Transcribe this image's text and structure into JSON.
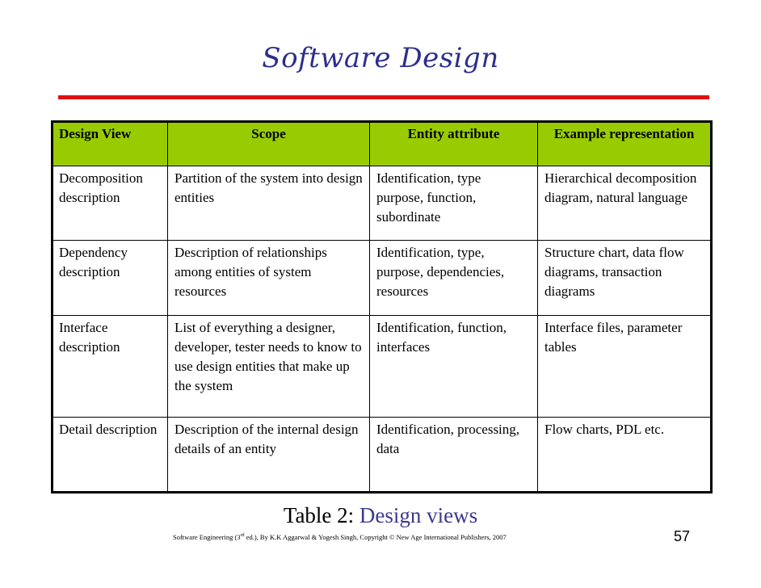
{
  "slide": {
    "title": "Software Design",
    "accent_color": "#2e2e8c",
    "rule_color": "#e01010",
    "header_bg_color": "#99cc00"
  },
  "table": {
    "headers": [
      "Design View",
      "Scope",
      "Entity attribute",
      "Example representation"
    ],
    "rows": [
      {
        "design_view": "Decomposition description",
        "scope": "Partition of the system into design entities",
        "entity_attribute": "Identification, type purpose, function, subordinate",
        "example": "Hierarchical decomposition diagram, natural language"
      },
      {
        "design_view": "Dependency description",
        "scope": "Description of relationships among entities of system resources",
        "entity_attribute": "Identification, type, purpose, dependencies, resources",
        "example": "Structure chart, data flow diagrams, transaction diagrams"
      },
      {
        "design_view": "Interface description",
        "scope": "List of everything a designer, developer, tester needs to know to use design entities that make up the system",
        "entity_attribute": "Identification, function, interfaces",
        "example": "Interface files, parameter tables"
      },
      {
        "design_view": "Detail description",
        "scope": "Description of the internal design details of an entity",
        "entity_attribute": "Identification, processing, data",
        "example": "Flow charts, PDL etc."
      }
    ]
  },
  "caption": {
    "prefix": "Table 2: ",
    "highlight": "Design views"
  },
  "footer": {
    "text_before_sup": "Software Engineering (3",
    "sup": "rd",
    "text_after_sup": " ed.), By K.K Aggarwal & Yogesh Singh, Copyright © New Age International Publishers, 2007",
    "page_number": "57"
  }
}
